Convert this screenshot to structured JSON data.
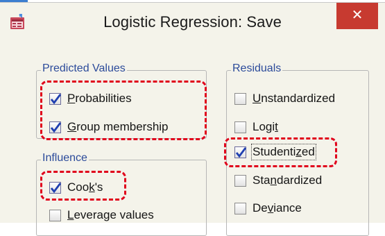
{
  "window": {
    "title": "Logistic Regression: Save",
    "close_glyph": "✕",
    "icon": "spss-dialog-icon"
  },
  "predicted_values": {
    "legend": "Predicted Values",
    "options": [
      {
        "pre": "",
        "u": "P",
        "post": "robabilities",
        "checked": true
      },
      {
        "pre": "",
        "u": "G",
        "post": "roup membership",
        "checked": true
      }
    ]
  },
  "influence": {
    "legend": "Influence",
    "options": [
      {
        "pre": "Coo",
        "u": "k",
        "post": "'s",
        "checked": true
      },
      {
        "pre": "",
        "u": "L",
        "post": "everage values",
        "checked": false
      }
    ]
  },
  "residuals": {
    "legend": "Residuals",
    "options": [
      {
        "pre": "",
        "u": "U",
        "post": "nstandardized",
        "checked": false
      },
      {
        "pre": "Logi",
        "u": "t",
        "post": "",
        "checked": false
      },
      {
        "pre": "Studenti",
        "u": "z",
        "post": "ed",
        "checked": true
      },
      {
        "pre": "Sta",
        "u": "n",
        "post": "dardized",
        "checked": false
      },
      {
        "pre": "De",
        "u": "v",
        "post": "iance",
        "checked": false
      }
    ]
  },
  "colors": {
    "highlight": "#e0001b",
    "legend_text": "#2b4a9a",
    "close_button": "#c73a30"
  }
}
